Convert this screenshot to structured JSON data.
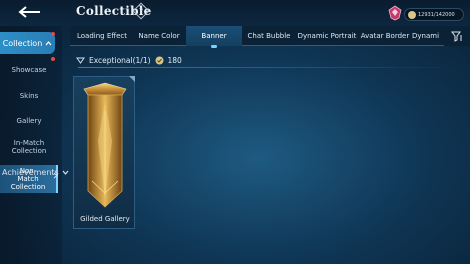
{
  "header": {
    "title": "Collectible",
    "help_icon": "?",
    "score": "12931/142000"
  },
  "tabs": [
    {
      "label": "Loading Effect"
    },
    {
      "label": "Name Color"
    },
    {
      "label": "Banner"
    },
    {
      "label": "Chat Bubble"
    },
    {
      "label": "Dynamic Portrait"
    },
    {
      "label": "Avatar Border"
    },
    {
      "label": "Dynami"
    }
  ],
  "sidebar": {
    "header": "Collection",
    "items": [
      {
        "label": "Showcase"
      },
      {
        "label": "Skins"
      },
      {
        "label": "Gallery"
      },
      {
        "label": "In-Match Collection"
      },
      {
        "label": "Non-Match Collection"
      }
    ],
    "achievements": "Achievements"
  },
  "rarity": {
    "label": "Exceptional(1/1)",
    "points": "180"
  },
  "cards": [
    {
      "name": "Gilded Gallery"
    }
  ],
  "colors": {
    "accent": "#2d8ec7",
    "gold": "#e0b54a",
    "notification": "#e34a4a"
  }
}
